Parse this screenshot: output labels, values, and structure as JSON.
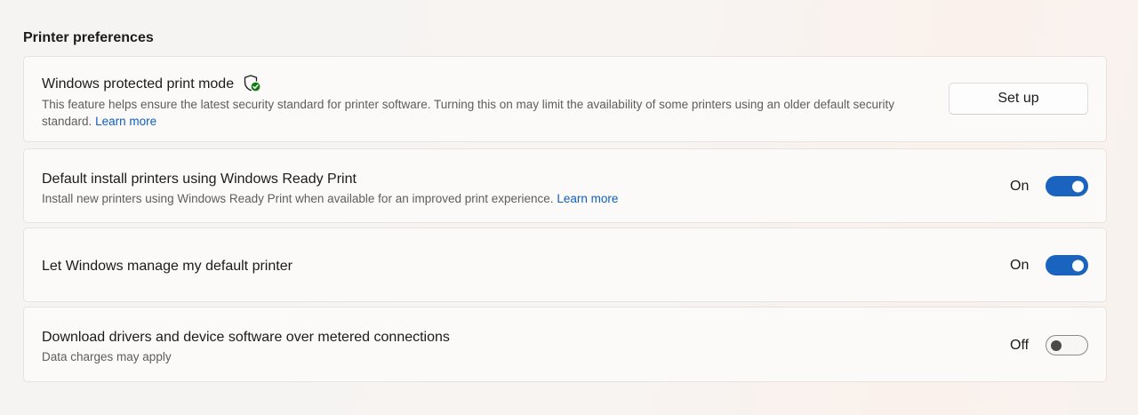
{
  "section": {
    "title": "Printer preferences"
  },
  "protected_mode": {
    "title": "Windows protected print mode",
    "icon": "shield-check-icon",
    "description": "This feature helps ensure the latest security standard for printer software. Turning this on may limit the availability of some printers using an older default security standard.",
    "link": "Learn more",
    "button_label": "Set up"
  },
  "ready_print": {
    "title": "Default install printers using Windows Ready Print",
    "description": "Install new printers using Windows Ready Print when available for an improved print experience.",
    "link": "Learn more",
    "state_label": "On",
    "enabled": true
  },
  "manage_default": {
    "title": "Let Windows manage my default printer",
    "state_label": "On",
    "enabled": true
  },
  "metered": {
    "title": "Download drivers and device software over metered connections",
    "description": "Data charges may apply",
    "state_label": "Off",
    "enabled": false
  },
  "colors": {
    "accent": "#1a64c0",
    "link": "#0f5fb8",
    "shield_green": "#107c10"
  }
}
